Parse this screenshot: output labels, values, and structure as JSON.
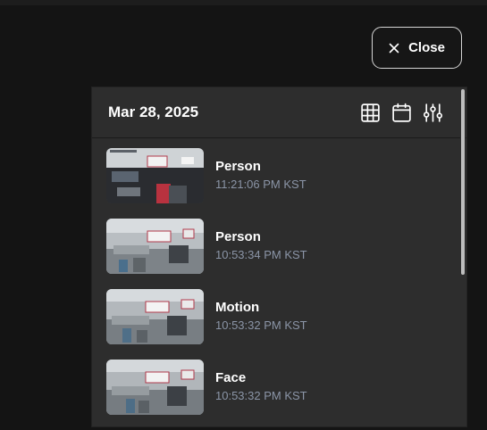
{
  "close_button": {
    "label": "Close",
    "icon": "close-icon"
  },
  "panel": {
    "date": "Mar 28, 2025",
    "header_icons": [
      "grid-icon",
      "calendar-icon",
      "filter-sliders-icon"
    ],
    "events": [
      {
        "type": "Person",
        "time": "11:21:06 PM KST"
      },
      {
        "type": "Person",
        "time": "10:53:34 PM KST"
      },
      {
        "type": "Motion",
        "time": "10:53:32 PM KST"
      },
      {
        "type": "Face",
        "time": "10:53:32 PM KST"
      }
    ]
  },
  "colors": {
    "background": "#141414",
    "panel": "#2d2d2d",
    "time_text": "#8b95a7",
    "scroll_thumb": "#bdbdbd"
  }
}
